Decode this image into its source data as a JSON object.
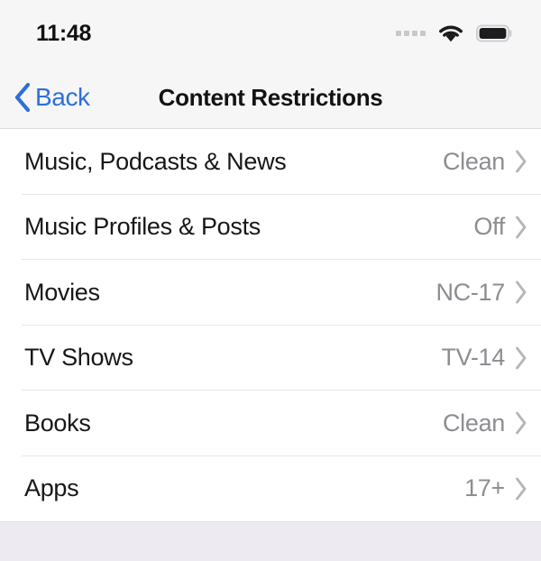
{
  "status_bar": {
    "time": "11:48",
    "signal_icon": "cellular-dots-icon",
    "wifi_icon": "wifi-icon",
    "battery_icon": "battery-full-icon",
    "dot_color": "#c7c7cc",
    "icon_color": "#1c1c1e"
  },
  "nav_bar": {
    "back_label": "Back",
    "back_icon": "chevron-left-icon",
    "title": "Content Restrictions",
    "accent_color": "#2f6fd8",
    "background_color": "#f6f6f7"
  },
  "list": {
    "chevron_icon": "chevron-right-icon",
    "value_color": "#8d8d92",
    "separator_color": "#e7e7e9",
    "rows": [
      {
        "label": "Music, Podcasts & News",
        "value": "Clean"
      },
      {
        "label": "Music Profiles & Posts",
        "value": "Off"
      },
      {
        "label": "Movies",
        "value": "NC-17"
      },
      {
        "label": "TV Shows",
        "value": "TV-14"
      },
      {
        "label": "Books",
        "value": "Clean"
      },
      {
        "label": "Apps",
        "value": "17+"
      }
    ]
  },
  "footer": {
    "background_color": "#edebf1"
  }
}
